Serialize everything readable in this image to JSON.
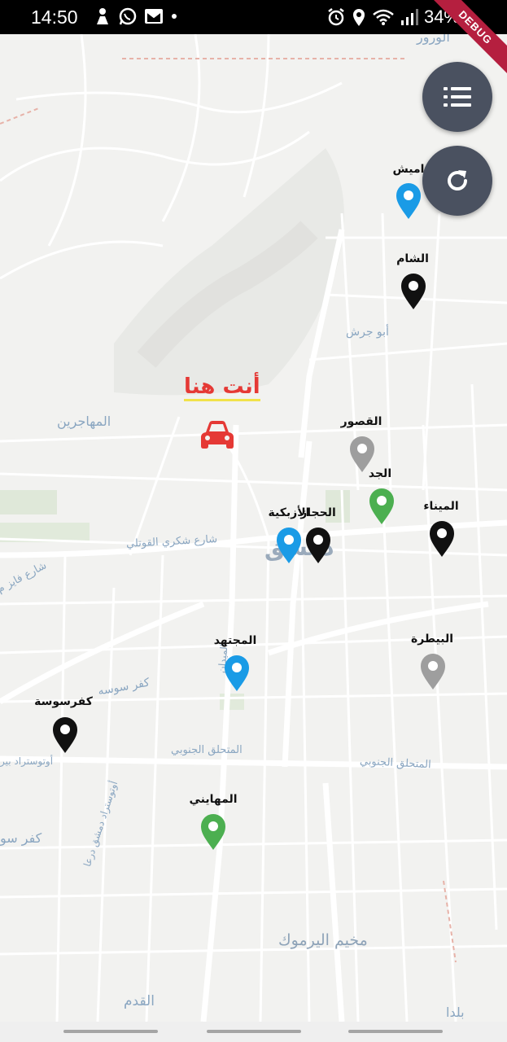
{
  "status_bar": {
    "time": "14:50",
    "battery": "34%"
  },
  "debug_banner": "DEBUG",
  "map": {
    "current_location_label": "أنت  هنا",
    "places": [
      {
        "text": "المهاجرين"
      },
      {
        "text": "أبو جرش"
      },
      {
        "text": "دمشق"
      },
      {
        "text": "شارع شكري القوتلي"
      },
      {
        "text": "كفر سوسه"
      },
      {
        "text": "المتحلق الجنوبي"
      },
      {
        "text": "المتحلق الجنوبي"
      },
      {
        "text": "مخيم اليرموك"
      },
      {
        "text": "القدم"
      },
      {
        "text": "كفر سو"
      },
      {
        "text": "الورور"
      },
      {
        "text": "شارع فايز م"
      },
      {
        "text": "أوتوستراد دمشق درعا"
      },
      {
        "text": "أوتوستراد بير"
      },
      {
        "text": "الميدان"
      },
      {
        "text": "بلدا"
      }
    ],
    "markers": [
      {
        "label": "اميش",
        "color": "#1a9be6"
      },
      {
        "label": "الشام",
        "color": "#111111"
      },
      {
        "label": "القصور",
        "color": "#9e9e9e"
      },
      {
        "label": "الجد",
        "color": "#4caf50"
      },
      {
        "label": "الحجاز",
        "color": "#111111"
      },
      {
        "label": "الأزبكية",
        "color": "#1a9be6"
      },
      {
        "label": "الميناء",
        "color": "#111111"
      },
      {
        "label": "المجتهد",
        "color": "#1a9be6"
      },
      {
        "label": "البيطرة",
        "color": "#9e9e9e"
      },
      {
        "label": "كفرسوسة",
        "color": "#111111"
      },
      {
        "label": "المهايني",
        "color": "#4caf50"
      }
    ]
  },
  "buttons": {
    "list_icon": "list-icon",
    "refresh_icon": "refresh-icon"
  },
  "colors": {
    "fab": "#4a5160",
    "car": "#e53935",
    "here_underline": "#f1e24a"
  }
}
